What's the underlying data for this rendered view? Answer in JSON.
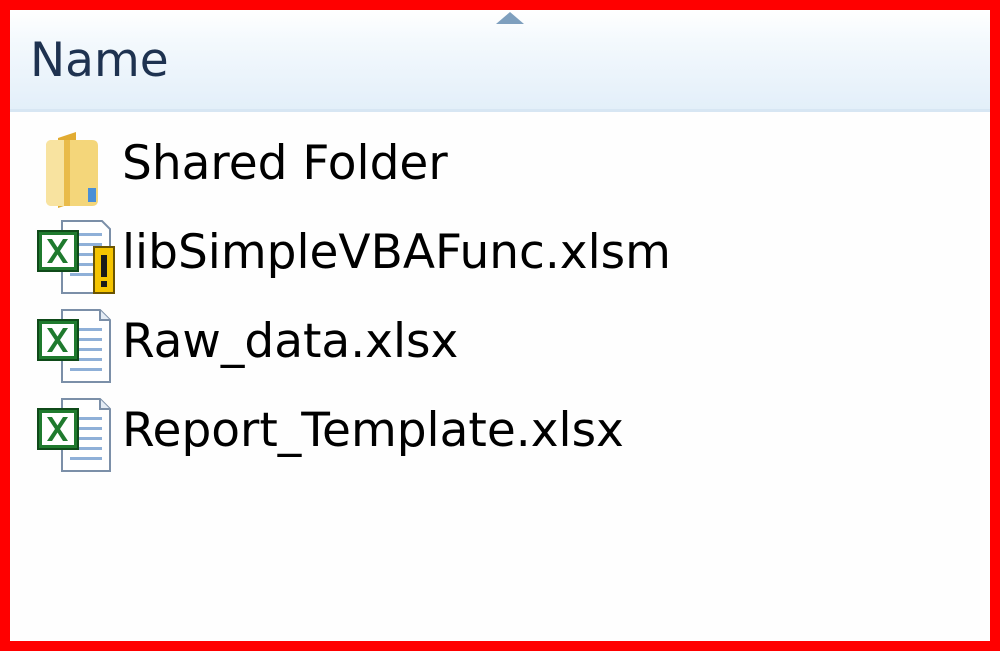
{
  "column_header": {
    "label": "Name"
  },
  "files": [
    {
      "name": "Shared Folder",
      "icon": "folder-icon"
    },
    {
      "name": "libSimpleVBAFunc.xlsm",
      "icon": "excel-macro-icon"
    },
    {
      "name": "Raw_data.xlsx",
      "icon": "excel-file-icon"
    },
    {
      "name": "Report_Template.xlsx",
      "icon": "excel-file-icon"
    }
  ],
  "colors": {
    "highlight_border": "#ff0000",
    "header_gradient_end": "#e3eff9",
    "excel_green": "#1f7a2e",
    "folder_yellow": "#f0c850"
  }
}
